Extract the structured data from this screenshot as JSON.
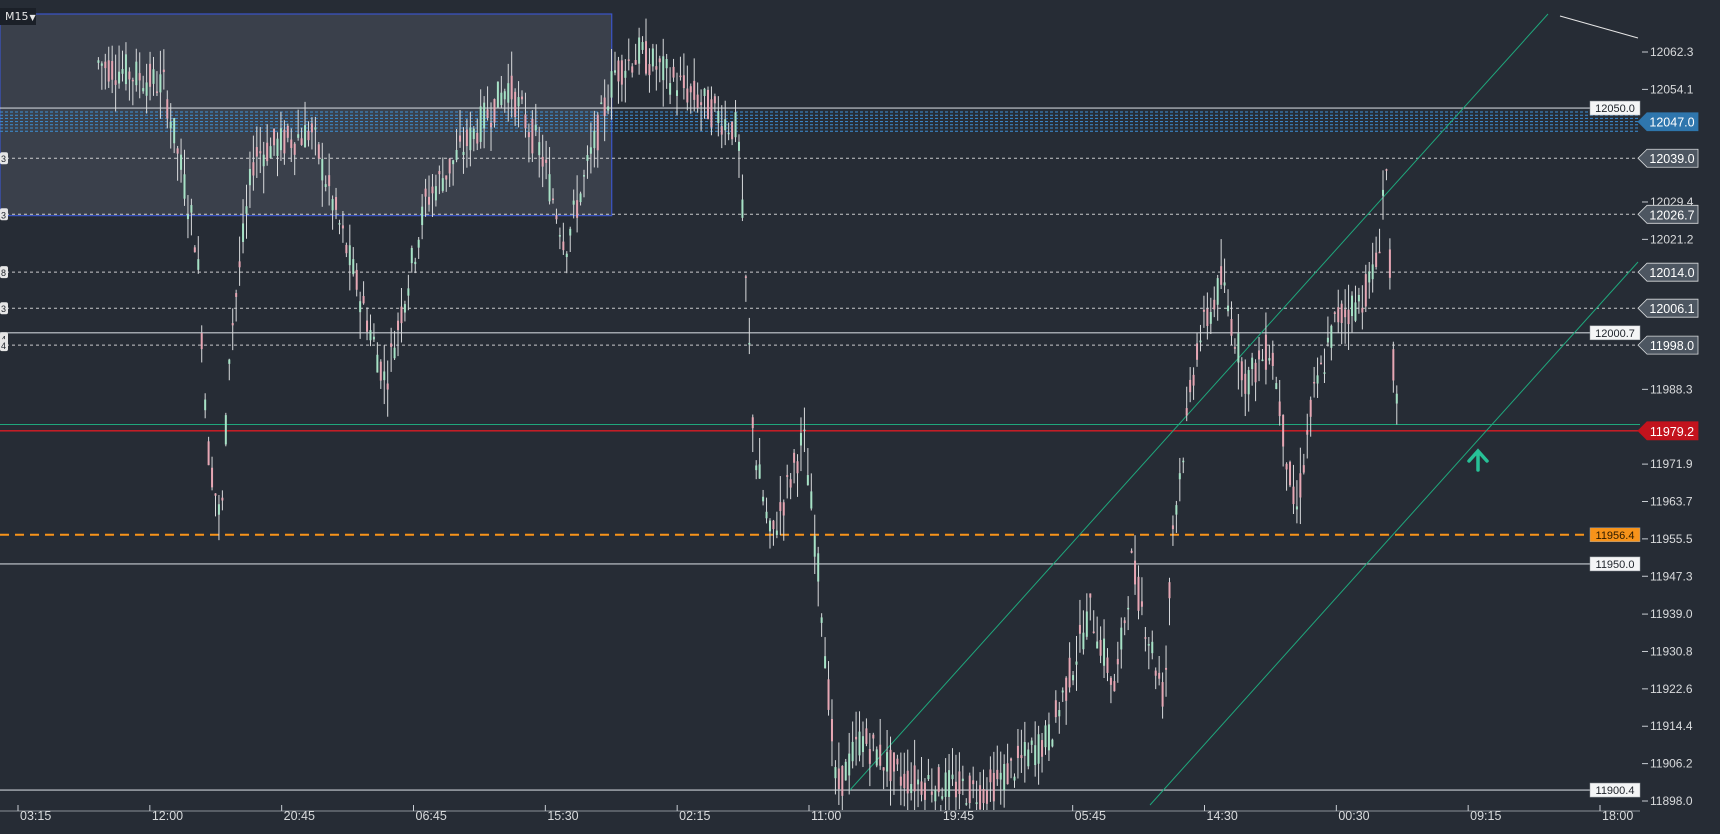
{
  "timeframe": "M15",
  "chart_data": {
    "type": "candlestick",
    "title": "",
    "xlabel": "",
    "ylabel": "",
    "ylim": [
      11898.0,
      12062.3
    ],
    "grid": false,
    "x_ticks": [
      "03:15",
      "12:00",
      "20:45",
      "06:45",
      "15:30",
      "02:15",
      "11:00",
      "19:45",
      "05:45",
      "14:30",
      "00:30",
      "09:15",
      "18:00"
    ],
    "y_ticks": [
      "12062.3",
      "12054.1",
      "12029.4",
      "12021.2",
      "11988.3",
      "11971.9",
      "11963.7",
      "11955.5",
      "11947.3",
      "11939.0",
      "11930.8",
      "11922.6",
      "11914.4",
      "11906.2",
      "11898.0"
    ],
    "price_tags": [
      {
        "label": "12047.0",
        "price": 12047.0,
        "style": "blue"
      },
      {
        "label": "12039.0",
        "price": 12039.0,
        "style": "slate"
      },
      {
        "label": "12026.7",
        "price": 12026.7,
        "style": "slate"
      },
      {
        "label": "12014.0",
        "price": 12014.0,
        "style": "slate"
      },
      {
        "label": "12006.1",
        "price": 12006.1,
        "style": "slate"
      },
      {
        "label": "11998.0",
        "price": 11998.0,
        "style": "slate"
      },
      {
        "label": "11979.2",
        "price": 11979.2,
        "style": "red"
      }
    ],
    "level_boxes": [
      {
        "label": "12050.0",
        "price": 12050.0,
        "color": "#c8cdd3"
      },
      {
        "label": "12000.7",
        "price": 12000.7,
        "color": "#c8cdd3"
      },
      {
        "label": "11956.4",
        "price": 11956.4,
        "color": "#f7931a"
      },
      {
        "label": "11950.0",
        "price": 11950.0,
        "color": "#c8cdd3"
      },
      {
        "label": "11900.4",
        "price": 11900.4,
        "color": "#c8cdd3"
      }
    ],
    "left_tags": [
      {
        "label": "3",
        "price": 12039.0
      },
      {
        "label": "3",
        "price": 12026.7
      },
      {
        "label": "8",
        "price": 12014.0
      },
      {
        "label": "3",
        "price": 12006.1
      },
      {
        "label": "4",
        "price": 11999.5
      },
      {
        "label": "4",
        "price": 11998.0
      }
    ],
    "zone": {
      "from_price": 12026.4,
      "to_price": 12062.3,
      "x_start": 0,
      "x_end": 0.373
    },
    "current_price": 11979.2,
    "colors": {
      "background": "#262c35",
      "bull": "#a7e2c6",
      "bear": "#e6a7b4",
      "wick": "#d8dadc",
      "channel": "#1fa77c",
      "current": "#d91b24",
      "level": "#c8cdd3",
      "dashed": "#e6e6e6",
      "orange": "#f7931a",
      "blue_band": "#3d8fd6",
      "arrow": "#27c197"
    }
  }
}
